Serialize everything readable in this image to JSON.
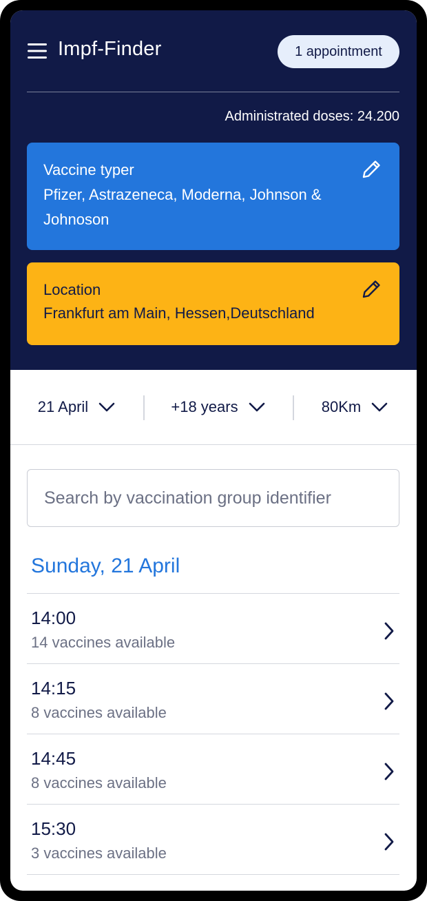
{
  "app": {
    "title": "Impf-Finder",
    "appointment_badge": "1 appointment",
    "doses_label": "Administrated doses: 24.200"
  },
  "cards": {
    "vaccine": {
      "label": "Vaccine typer",
      "value": "Pfizer, Astrazeneca, Moderna, Johnson & Johnoson",
      "color": "#2376dc",
      "icon": "pencil-icon"
    },
    "location": {
      "label": "Location",
      "value": "Frankfurt am Main, Hessen,Deutschland",
      "color": "#fdb315",
      "icon": "pencil-icon"
    }
  },
  "filters": {
    "date": "21 April",
    "age": "+18 years",
    "distance": "80Km"
  },
  "search": {
    "placeholder": "Search by vaccination group identifier",
    "value": ""
  },
  "date_heading": "Sunday, 21 April",
  "slots": [
    {
      "time": "14:00",
      "availability": "14 vaccines available"
    },
    {
      "time": "14:15",
      "availability": "8 vaccines available"
    },
    {
      "time": "14:45",
      "availability": "8 vaccines available"
    },
    {
      "time": "15:30",
      "availability": "3 vaccines available"
    }
  ],
  "colors": {
    "header_bg": "#111a47",
    "accent_blue": "#2376dc",
    "accent_yellow": "#fdb315",
    "text_dark": "#111a47",
    "text_muted": "#6b7084"
  }
}
